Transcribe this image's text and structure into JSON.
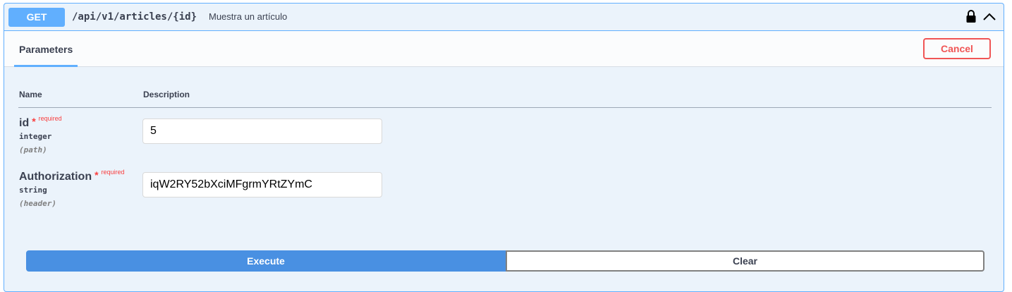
{
  "endpoint": {
    "method": "GET",
    "path": "/api/v1/articles/{id}",
    "description": "Muestra un artículo",
    "lock_icon": "lock-icon",
    "collapse_icon": "chevron-up-icon"
  },
  "section": {
    "tab_label": "Parameters",
    "cancel_label": "Cancel"
  },
  "table": {
    "col_name": "Name",
    "col_description": "Description"
  },
  "params": [
    {
      "name": "id",
      "required_mark": "*",
      "required_label": "required",
      "type": "integer",
      "in": "(path)",
      "value": "5"
    },
    {
      "name": "Authorization",
      "required_mark": "*",
      "required_label": "required",
      "type": "string",
      "in": "(header)",
      "value": "iqW2RY52bXciMFgrmYRtZYmC"
    }
  ],
  "actions": {
    "execute_label": "Execute",
    "clear_label": "Clear"
  },
  "colors": {
    "get_accent": "#61affe",
    "block_bg": "#ebf3fb",
    "danger": "#f93e3e",
    "execute_bg": "#4990e2"
  }
}
